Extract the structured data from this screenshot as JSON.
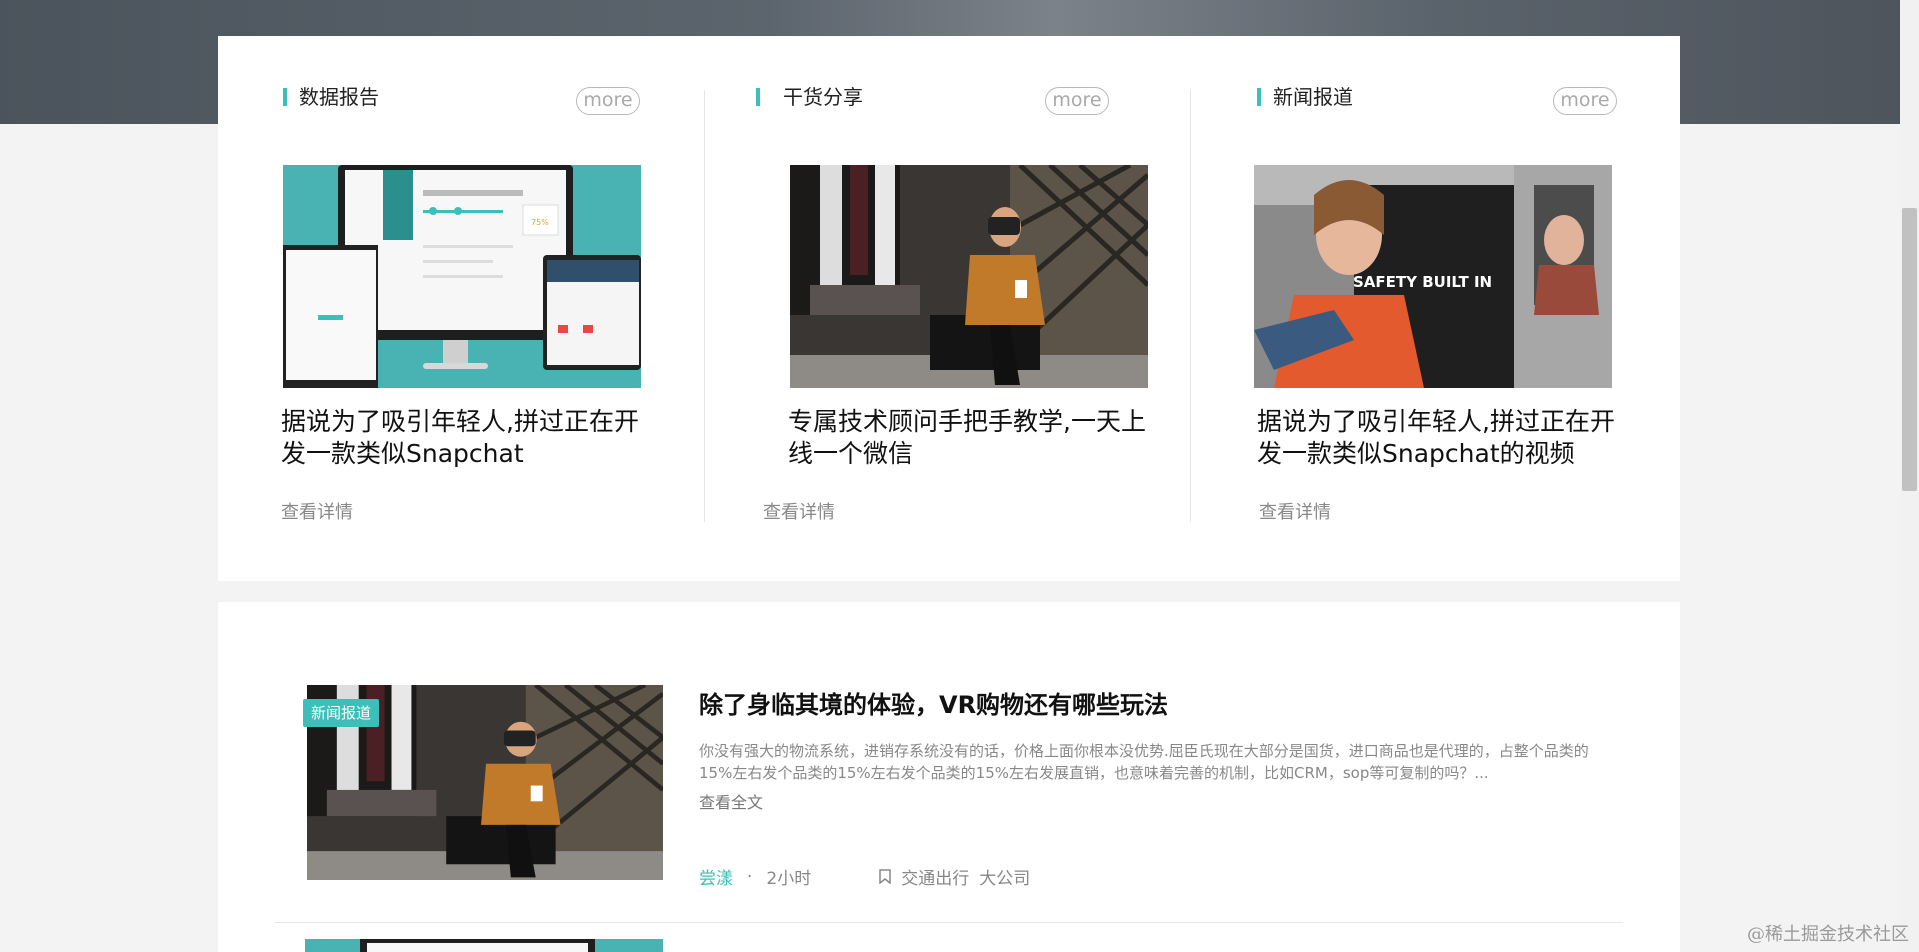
{
  "columns": [
    {
      "title": "数据报告",
      "more_label": "more",
      "headline": "据说为了吸引年轻人,拼过正在开发一款类似Snapchat",
      "detail_label": "查看详情"
    },
    {
      "title": "干货分享",
      "more_label": "more",
      "headline": "专属技术顾问手把手教学,一天上线一个微信",
      "detail_label": "查看详情"
    },
    {
      "title": "新闻报道",
      "more_label": "more",
      "headline": "据说为了吸引年轻人,拼过正在开发一款类似Snapchat的视频",
      "detail_label": "查看详情",
      "image_text": "SAFETY BUILT IN"
    }
  ],
  "article": {
    "tag": "新闻报道",
    "title": "除了身临其境的体验，VR购物还有哪些玩法",
    "description": "你没有强大的物流系统，进销存系统没有的话，价格上面你根本没优势.屈臣氏现在大部分是国货，进口商品也是代理的，占整个品类的15%左右发个品类的15%左右发个品类的15%左右发展直销，也意味着完善的机制，比如CRM，sop等可复制的吗？...",
    "read_all": "查看全文",
    "author": "尝漾",
    "dot": "·",
    "time": "2小时",
    "bookmark_icon": "bookmark-icon",
    "categories": [
      "交通出行",
      "大公司"
    ]
  },
  "watermark": "@稀土掘金技术社区",
  "colors": {
    "accent": "#3cbfb8"
  }
}
